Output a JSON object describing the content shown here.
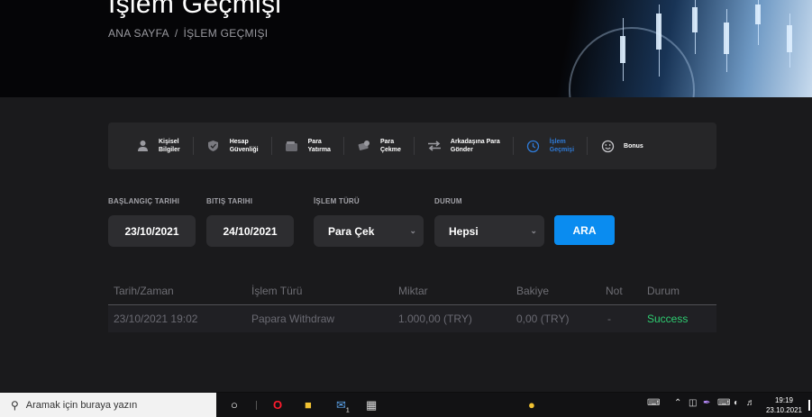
{
  "hero": {
    "title": "İşlem Geçmişi",
    "breadcrumb": {
      "home": "ANA SAYFA",
      "separator": "/",
      "current": "İŞLEM GEÇMIŞI"
    }
  },
  "tabs": [
    {
      "label": "Kişisel\nBilgiler",
      "icon": "person-icon"
    },
    {
      "label": "Hesap\nGüvenliği",
      "icon": "shield-icon"
    },
    {
      "label": "Para\nYatırma",
      "icon": "wallet-icon"
    },
    {
      "label": "Para\nÇekme",
      "icon": "cash-icon"
    },
    {
      "label": "Arkadaşına Para\nGönder",
      "icon": "transfer-icon"
    },
    {
      "label": "İşlem\nGeçmişi",
      "icon": "history-icon",
      "active": true
    },
    {
      "label": "Bonus",
      "icon": "smile-icon"
    }
  ],
  "filters": {
    "start_label": "BAŞLANGIÇ TARIHI",
    "start_value": "23/10/2021",
    "end_label": "BITIŞ TARIHI",
    "end_value": "24/10/2021",
    "type_label": "İŞLEM TÜRÜ",
    "type_value": "Para Çek",
    "status_label": "DURUM",
    "status_value": "Hepsi",
    "search_button": "ARA"
  },
  "table": {
    "headers": [
      "Tarih/Zaman",
      "İşlem Türü",
      "Miktar",
      "Bakiye",
      "Not",
      "Durum"
    ],
    "rows": [
      [
        "23/10/2021 19:02",
        "Papara Withdraw",
        "1.000,00 (TRY)",
        "0,00 (TRY)",
        "-",
        "Success"
      ]
    ]
  },
  "taskbar": {
    "search_placeholder": "Aramak için buraya yazın",
    "mail_badge": "1",
    "time": "19:19",
    "date": "23.10.2021"
  },
  "colors": {
    "accent": "#0a8cf0",
    "active_tab": "#2f7bd8",
    "success": "#2ecc71",
    "background": "#1a1a1c"
  }
}
